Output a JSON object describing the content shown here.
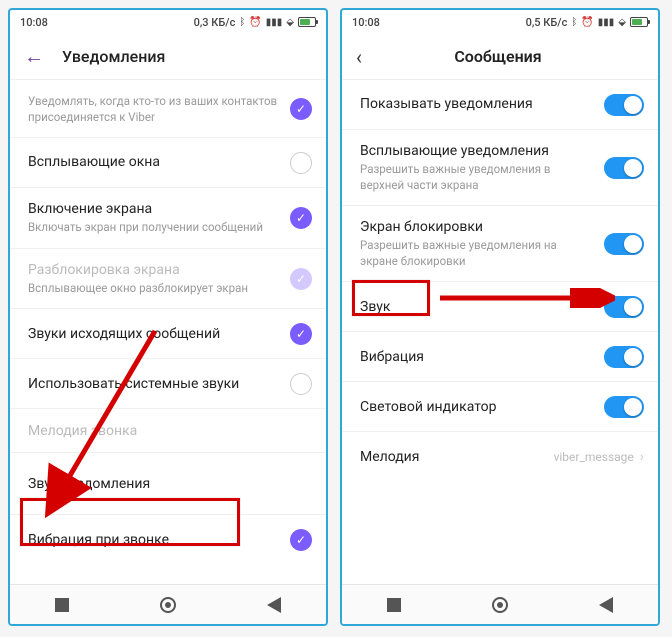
{
  "status": {
    "time": "10:08",
    "speed_left": "0,3 КБ/с",
    "speed_right": "0,5 КБ/с"
  },
  "left": {
    "title": "Уведомления",
    "rows": [
      {
        "label": "",
        "sub": "Уведомлять, когда кто-то из ваших контактов присоединяется к Viber",
        "state": "on"
      },
      {
        "label": "Всплывающие окна",
        "state": "off"
      },
      {
        "label": "Включение экрана",
        "sub": "Включать экран при получении сообщений",
        "state": "on"
      },
      {
        "label": "Разблокировка экрана",
        "sub": "Всплывающее окно разблокирует экран",
        "state": "dim",
        "dim": true
      },
      {
        "label": "Звуки исходящих сообщений",
        "state": "on"
      },
      {
        "label": "Использовать системные звуки",
        "state": "off"
      },
      {
        "label": "Мелодия звонка",
        "state": "none",
        "dim": true
      },
      {
        "label": "Звук уведомления",
        "state": "none"
      },
      {
        "label": "Вибрация при звонке",
        "state": "on"
      }
    ]
  },
  "right": {
    "title": "Сообщения",
    "rows": [
      {
        "label": "Показывать уведомления",
        "toggle": true
      },
      {
        "label": "Всплывающие уведомления",
        "sub": "Разрешить важные уведомления в верхней части экрана",
        "toggle": true
      },
      {
        "label": "Экран блокировки",
        "sub": "Разрешить важные уведомления на экране блокировки",
        "toggle": true
      },
      {
        "label": "Звук",
        "toggle": true
      },
      {
        "label": "Вибрация",
        "toggle": true
      },
      {
        "label": "Световой индикатор",
        "toggle": true
      },
      {
        "label": "Мелодия",
        "value": "viber_message"
      }
    ]
  }
}
